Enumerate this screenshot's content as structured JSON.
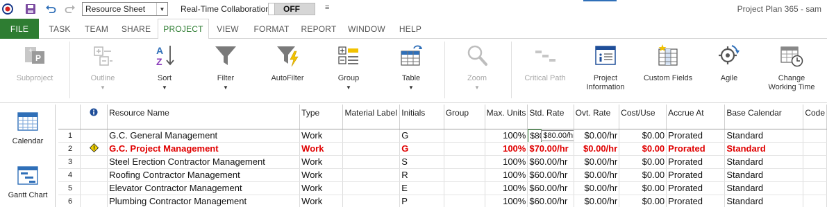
{
  "app": {
    "title": "Project Plan 365 - sam"
  },
  "qat": {
    "view_select_value": "Resource Sheet",
    "collab_label": "Real-Time Collaboration",
    "collab_state": "OFF"
  },
  "tabs": [
    "FILE",
    "TASK",
    "TEAM",
    "SHARE",
    "PROJECT",
    "VIEW",
    "FORMAT",
    "REPORT",
    "WINDOW",
    "HELP"
  ],
  "active_tab": "PROJECT",
  "ribbon": {
    "subproject": "Subproject",
    "outline": "Outline",
    "sort": "Sort",
    "filter": "Filter",
    "autofilter": "AutoFilter",
    "group": "Group",
    "table": "Table",
    "zoom": "Zoom",
    "critical_path": "Critical Path",
    "project_information_1": "Project",
    "project_information_2": "Information",
    "custom_fields": "Custom Fields",
    "agile": "Agile",
    "change_working_time_1": "Change",
    "change_working_time_2": "Working Time"
  },
  "sidebar": {
    "calendar": "Calendar",
    "gantt": "Gantt Chart"
  },
  "grid": {
    "headers": [
      "Resource Name",
      "Type",
      "Material Label",
      "Initials",
      "Group",
      "Max. Units",
      "Std. Rate",
      "Ovt. Rate",
      "Cost/Use",
      "Accrue At",
      "Base Calendar",
      "Code"
    ],
    "rows": [
      {
        "id": "1",
        "name": "G.C. General Management",
        "type": "Work",
        "material": "",
        "initials": "G",
        "group": "",
        "max_units": "100%",
        "std_rate": "$80",
        "ovt_rate": "$0.00/hr",
        "cost_use": "$0.00",
        "accrue": "Prorated",
        "calendar": "Standard",
        "code": ""
      },
      {
        "id": "2",
        "name": "G.C. Project Management",
        "type": "Work",
        "material": "",
        "initials": "G",
        "group": "",
        "max_units": "100%",
        "std_rate": "$70.00/hr",
        "ovt_rate": "$0.00/hr",
        "cost_use": "$0.00",
        "accrue": "Prorated",
        "calendar": "Standard",
        "code": ""
      },
      {
        "id": "3",
        "name": "Steel Erection Contractor Management",
        "type": "Work",
        "material": "",
        "initials": "S",
        "group": "",
        "max_units": "100%",
        "std_rate": "$60.00/hr",
        "ovt_rate": "$0.00/hr",
        "cost_use": "$0.00",
        "accrue": "Prorated",
        "calendar": "Standard",
        "code": ""
      },
      {
        "id": "4",
        "name": "Roofing Contractor Management",
        "type": "Work",
        "material": "",
        "initials": "R",
        "group": "",
        "max_units": "100%",
        "std_rate": "$60.00/hr",
        "ovt_rate": "$0.00/hr",
        "cost_use": "$0.00",
        "accrue": "Prorated",
        "calendar": "Standard",
        "code": ""
      },
      {
        "id": "5",
        "name": "Elevator Contractor Management",
        "type": "Work",
        "material": "",
        "initials": "E",
        "group": "",
        "max_units": "100%",
        "std_rate": "$60.00/hr",
        "ovt_rate": "$0.00/hr",
        "cost_use": "$0.00",
        "accrue": "Prorated",
        "calendar": "Standard",
        "code": ""
      },
      {
        "id": "6",
        "name": "Plumbing Contractor Management",
        "type": "Work",
        "material": "",
        "initials": "P",
        "group": "",
        "max_units": "100%",
        "std_rate": "$60.00/hr",
        "ovt_rate": "$0.00/hr",
        "cost_use": "$0.00",
        "accrue": "Prorated",
        "calendar": "Standard",
        "code": ""
      }
    ],
    "edit_tooltip": "$80.00/hr"
  },
  "colors": {
    "file_tab": "#2e7d32",
    "active_tab_text": "#2e7d32",
    "overallocated_text": "#e00000"
  }
}
